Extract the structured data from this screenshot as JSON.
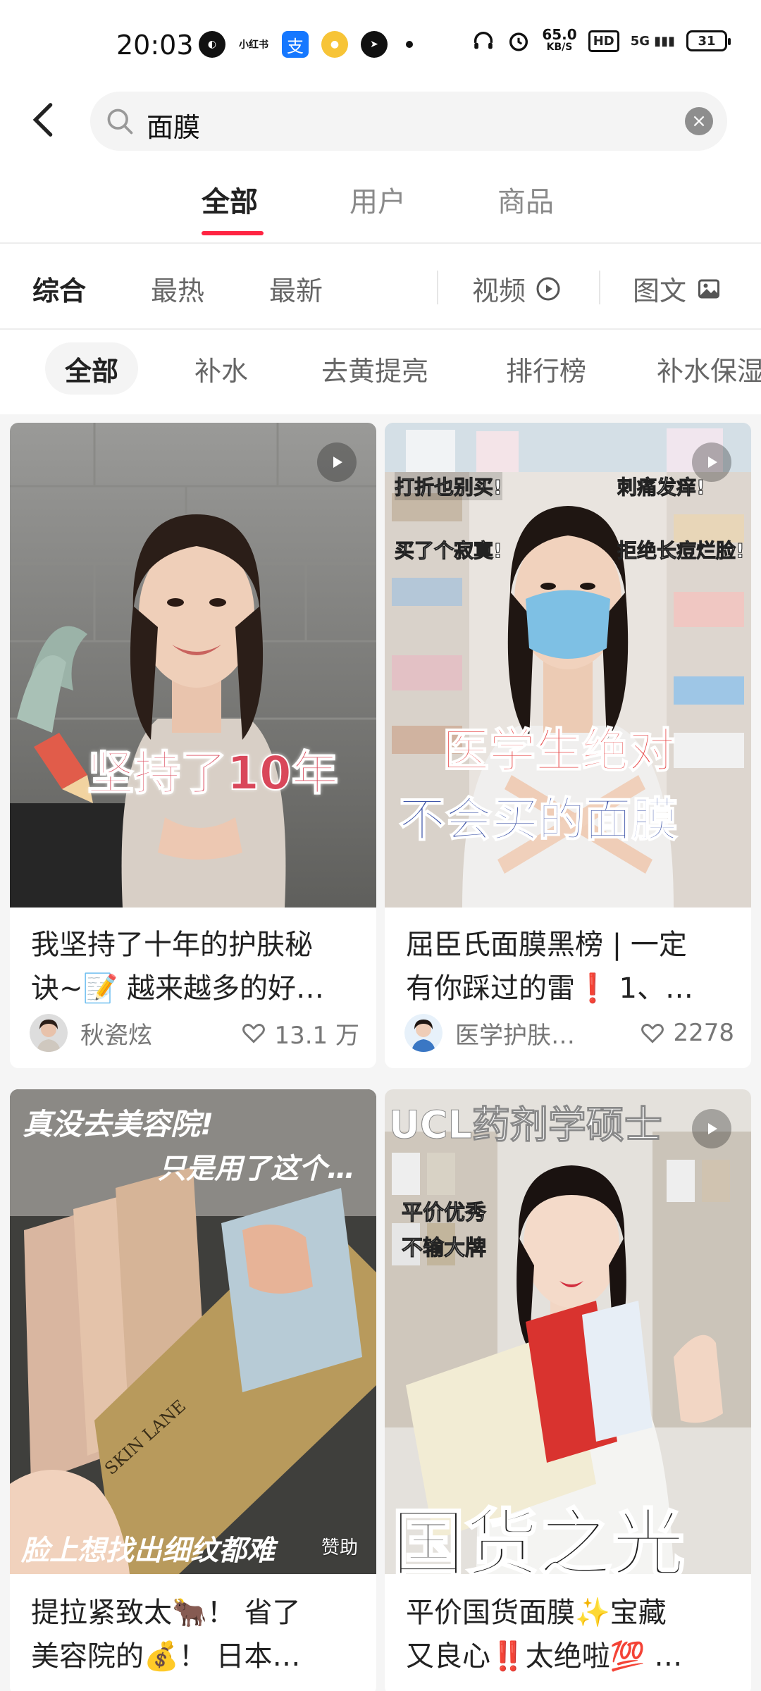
{
  "status_bar": {
    "time": "20:03",
    "xhs_icon_text": "小红书",
    "net_speed": "65.0",
    "net_unit": "KB/S",
    "hd": "HD",
    "signal": "5G",
    "battery": "31"
  },
  "search": {
    "query": "面膜"
  },
  "tabs": [
    "全部",
    "用户",
    "商品"
  ],
  "sort": {
    "items": [
      "综合",
      "最热",
      "最新"
    ],
    "types": [
      "视频",
      "图文"
    ]
  },
  "chips": [
    "全部",
    "补水",
    "去黄提亮",
    "排行榜",
    "补水保湿"
  ],
  "cards": [
    {
      "title_line1": "我坚持了十年的护肤秘",
      "title_line2": "诀~📝 越来越多的好…",
      "overlay": "坚持了10年",
      "author": "秋瓷炫",
      "likes": "13.1 万",
      "is_video": true
    },
    {
      "title_line1": "屈臣氏面膜黑榜 | 一定",
      "title_line2": "有你踩过的雷❗ 1、…",
      "overlay_tags": [
        "打折也别买!",
        "刺痛发痒!",
        "买了个寂寞!",
        "拒绝长痘烂脸!"
      ],
      "overlay_main1": "医学生绝对",
      "overlay_main2": "不会买的面膜",
      "author": "医学护肤…",
      "likes": "2278",
      "is_video": true
    },
    {
      "title_line1": "提拉紧致太🐂！ 省了",
      "title_line2": "美容院的💰！ 日本…",
      "overlay_top1": "真没去美容院!",
      "overlay_top2": "只是用了这个…",
      "overlay_bottom": "脸上想找出细纹都难",
      "brand": "SKIN LANE",
      "sponsor": "赞助"
    },
    {
      "title_line1": "平价国货面膜✨宝藏",
      "title_line2": "又良心‼️太绝啦💯 …",
      "overlay_top": "UCL药剂学硕士",
      "overlay_tag1": "平价优秀",
      "overlay_tag2": "不输大牌",
      "overlay_bottom": "国货之光",
      "is_video": true
    }
  ],
  "colors": {
    "accent": "#ff2442",
    "feed_bg": "#f5f5f5",
    "text_primary": "#222222",
    "text_secondary": "#777777"
  }
}
